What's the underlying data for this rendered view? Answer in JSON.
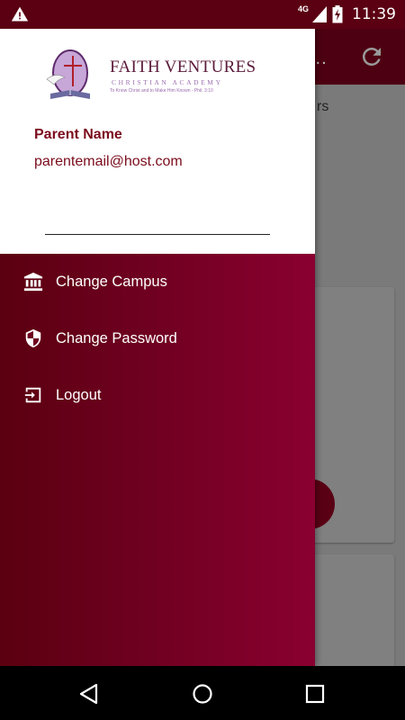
{
  "status_bar": {
    "network": "4G",
    "time": "11:39",
    "icons": [
      "warning-icon",
      "signal-icon",
      "battery-charging-icon"
    ]
  },
  "background_app": {
    "toolbar_overflow_text": "...",
    "refresh_icon": "refresh-icon",
    "partial_text": "rs"
  },
  "drawer": {
    "logo": {
      "brand": "FAITH VENTURES",
      "subtitle": "CHRISTIAN ACADEMY",
      "tagline": "To Know Christ and to Make Him Known - Phil. 3:10"
    },
    "parent_name": "Parent Name",
    "parent_email": "parentemail@host.com",
    "menu": [
      {
        "label": "Change Campus",
        "icon": "bank-icon"
      },
      {
        "label": "Change Password",
        "icon": "shield-icon"
      },
      {
        "label": "Logout",
        "icon": "logout-icon"
      }
    ]
  },
  "nav_bar": {
    "buttons": [
      "back-icon",
      "home-icon",
      "recents-icon"
    ]
  },
  "colors": {
    "status_bar": "#5a0012",
    "accent": "#7b0c1c",
    "menu_gradient_start": "#5b0010",
    "menu_gradient_end": "#8a0030"
  }
}
